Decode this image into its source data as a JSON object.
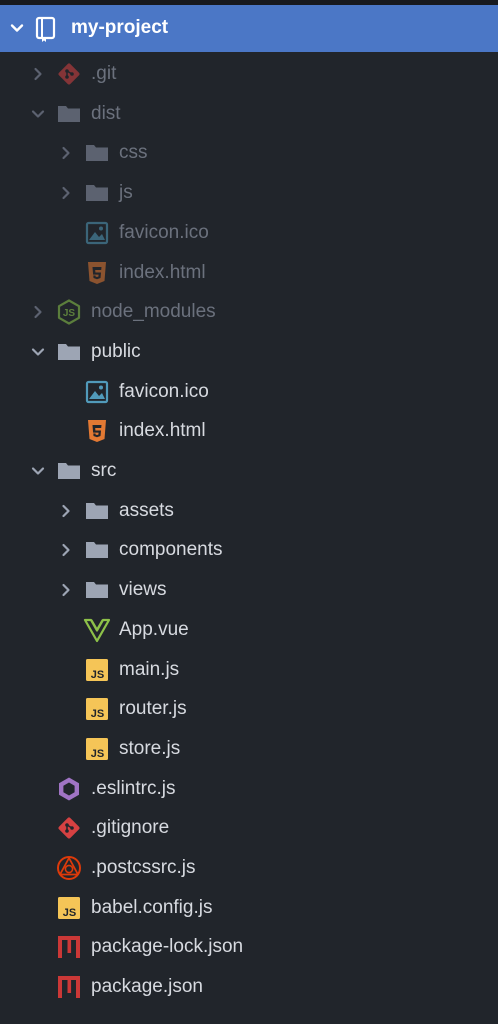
{
  "project": {
    "name": "my-project"
  },
  "tree": [
    {
      "label": ".git",
      "icon": "git-icon",
      "depth": 0,
      "toggle": "collapsed",
      "dim": true
    },
    {
      "label": "dist",
      "icon": "folder-icon",
      "depth": 0,
      "toggle": "expanded",
      "dim": true
    },
    {
      "label": "css",
      "icon": "folder-icon",
      "depth": 1,
      "toggle": "collapsed",
      "dim": true
    },
    {
      "label": "js",
      "icon": "folder-icon",
      "depth": 1,
      "toggle": "collapsed",
      "dim": true
    },
    {
      "label": "favicon.ico",
      "icon": "image-file-icon",
      "depth": 1,
      "toggle": "none",
      "dim": true
    },
    {
      "label": "index.html",
      "icon": "html5-icon",
      "depth": 1,
      "toggle": "none",
      "dim": true
    },
    {
      "label": "node_modules",
      "icon": "nodejs-icon",
      "depth": 0,
      "toggle": "collapsed",
      "dim": true
    },
    {
      "label": "public",
      "icon": "folder-icon",
      "depth": 0,
      "toggle": "expanded",
      "dim": false
    },
    {
      "label": "favicon.ico",
      "icon": "image-file-icon",
      "depth": 1,
      "toggle": "none",
      "dim": false
    },
    {
      "label": "index.html",
      "icon": "html5-icon",
      "depth": 1,
      "toggle": "none",
      "dim": false
    },
    {
      "label": "src",
      "icon": "folder-icon",
      "depth": 0,
      "toggle": "expanded",
      "dim": false
    },
    {
      "label": "assets",
      "icon": "folder-icon",
      "depth": 1,
      "toggle": "collapsed",
      "dim": false
    },
    {
      "label": "components",
      "icon": "folder-icon",
      "depth": 1,
      "toggle": "collapsed",
      "dim": false
    },
    {
      "label": "views",
      "icon": "folder-icon",
      "depth": 1,
      "toggle": "collapsed",
      "dim": false
    },
    {
      "label": "App.vue",
      "icon": "vue-icon",
      "depth": 1,
      "toggle": "none",
      "dim": false
    },
    {
      "label": "main.js",
      "icon": "js-icon",
      "depth": 1,
      "toggle": "none",
      "dim": false
    },
    {
      "label": "router.js",
      "icon": "js-icon",
      "depth": 1,
      "toggle": "none",
      "dim": false
    },
    {
      "label": "store.js",
      "icon": "js-icon",
      "depth": 1,
      "toggle": "none",
      "dim": false
    },
    {
      "label": ".eslintrc.js",
      "icon": "eslint-icon",
      "depth": 0,
      "toggle": "none",
      "dim": false
    },
    {
      "label": ".gitignore",
      "icon": "git-icon",
      "depth": 0,
      "toggle": "none",
      "dim": false
    },
    {
      "label": ".postcssrc.js",
      "icon": "postcss-icon",
      "depth": 0,
      "toggle": "none",
      "dim": false
    },
    {
      "label": "babel.config.js",
      "icon": "js-icon",
      "depth": 0,
      "toggle": "none",
      "dim": false
    },
    {
      "label": "package-lock.json",
      "icon": "npm-icon",
      "depth": 0,
      "toggle": "none",
      "dim": false
    },
    {
      "label": "package.json",
      "icon": "npm-icon",
      "depth": 0,
      "toggle": "none",
      "dim": false
    }
  ],
  "colors": {
    "background": "#21252b",
    "header": "#4b77c6",
    "text_bright": "#d7dae0",
    "text_dim": "#6b717d",
    "folder": "#9da5b4",
    "git": "#d54142",
    "html": "#e37933",
    "js": "#f5c557",
    "image": "#519aba",
    "node": "#8cc84b",
    "vue": "#8dc149",
    "eslint": "#a074c4",
    "postcss": "#dd3a0a",
    "npm": "#cb3837"
  }
}
